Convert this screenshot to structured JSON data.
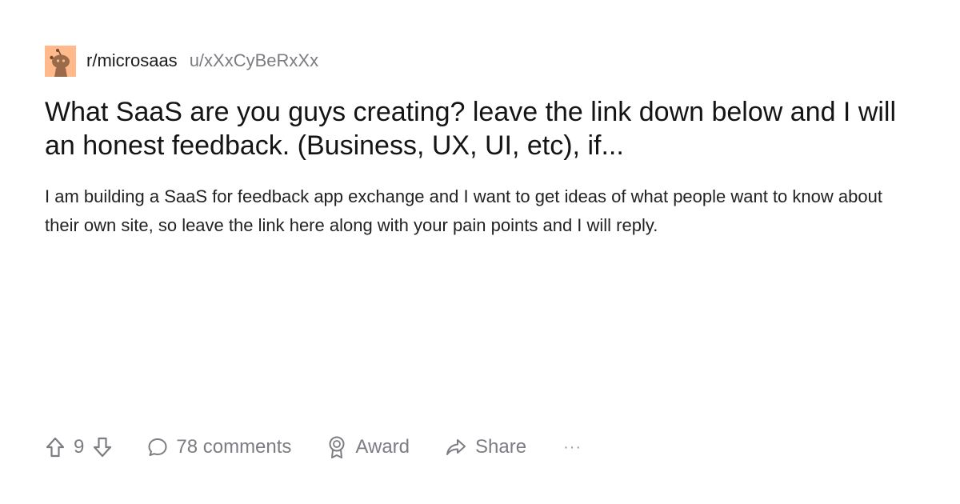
{
  "post": {
    "subreddit": "r/microsaas",
    "author": "u/xXxCyBeRxXx",
    "title": "What SaaS are you guys creating? leave the link down below and I will an honest feedback. (Business, UX, UI, etc), if...",
    "body": "I am building a SaaS for feedback app exchange and I want to get ideas of what people want to know about their own site, so leave the link here along with your pain points and I will reply."
  },
  "actions": {
    "vote_count": "9",
    "comments_label": "78 comments",
    "award_label": "Award",
    "share_label": "Share",
    "more_label": "···"
  },
  "icons": {
    "avatar": "snoo-avatar-icon",
    "upvote": "arrow-up-icon",
    "downvote": "arrow-down-icon",
    "comments": "speech-bubble-icon",
    "award": "award-ribbon-icon",
    "share": "share-arrow-icon"
  },
  "colors": {
    "avatar_bg": "#ffb98a",
    "muted_text": "#7c7c83"
  }
}
